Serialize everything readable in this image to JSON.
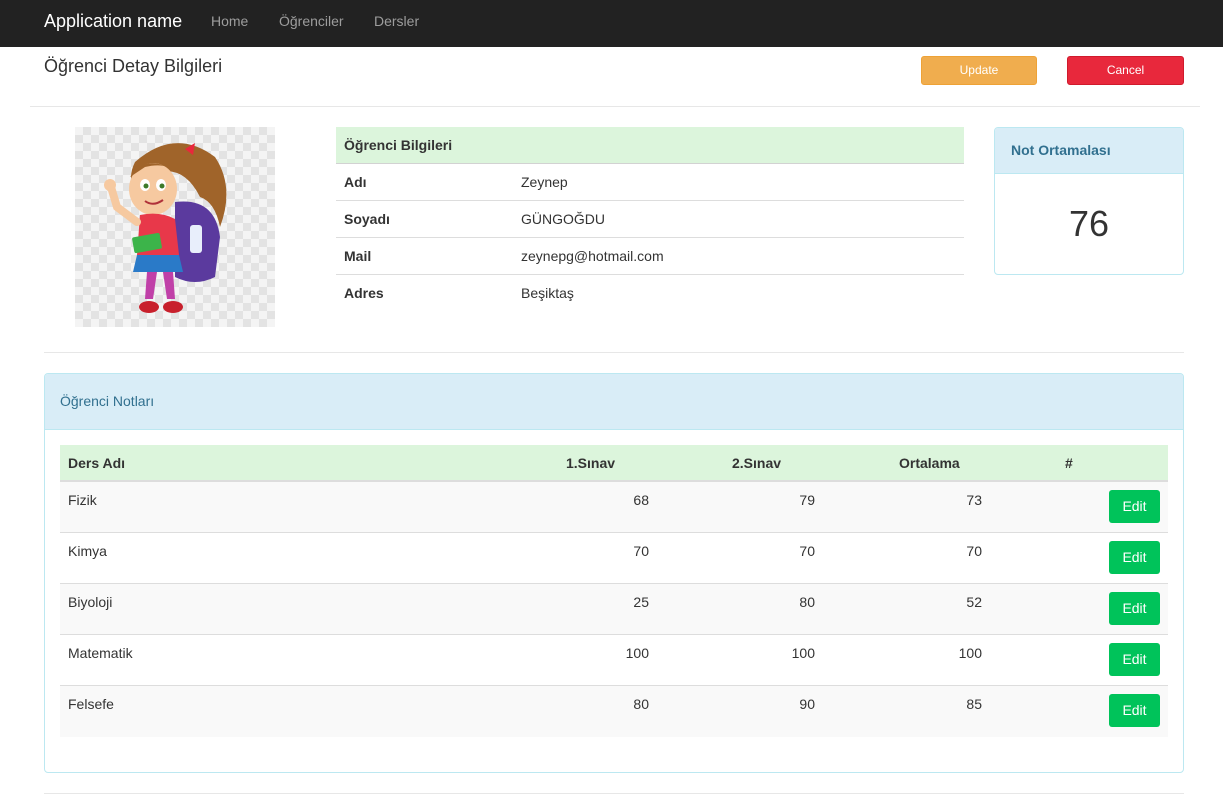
{
  "navbar": {
    "brand": "Application name",
    "links": [
      "Home",
      "Öğrenciler",
      "Dersler"
    ]
  },
  "page": {
    "title": "Öğrenci Detay Bilgileri",
    "update_label": "Update",
    "cancel_label": "Cancel"
  },
  "student": {
    "header": "Öğrenci Bilgileri",
    "fields": [
      {
        "label": "Adı",
        "value": "Zeynep"
      },
      {
        "label": "Soyadı",
        "value": "GÜNGOĞDU"
      },
      {
        "label": "Mail",
        "value": "zeynepg@hotmail.com"
      },
      {
        "label": "Adres",
        "value": "Beşiktaş"
      }
    ]
  },
  "average": {
    "title": "Not Ortamalası",
    "value": "76"
  },
  "grades": {
    "title": "Öğrenci Notları",
    "columns": [
      "Ders Adı",
      "1.Sınav",
      "2.Sınav",
      "Ortalama",
      "#"
    ],
    "rows": [
      {
        "name": "Fizik",
        "s1": "68",
        "s2": "79",
        "avg": "73",
        "action": "Edit"
      },
      {
        "name": "Kimya",
        "s1": "70",
        "s2": "70",
        "avg": "70",
        "action": "Edit"
      },
      {
        "name": "Biyoloji",
        "s1": "25",
        "s2": "80",
        "avg": "52",
        "action": "Edit"
      },
      {
        "name": "Matematik",
        "s1": "100",
        "s2": "100",
        "avg": "100",
        "action": "Edit"
      },
      {
        "name": "Felsefe",
        "s1": "80",
        "s2": "90",
        "avg": "85",
        "action": "Edit"
      }
    ]
  },
  "colors": {
    "navbar": "#222222",
    "update": "#f0ad4e",
    "cancel": "#e8283c",
    "edit": "#00c35a",
    "info_header": "#dcf5dc",
    "panel_header": "#d9edf7"
  }
}
